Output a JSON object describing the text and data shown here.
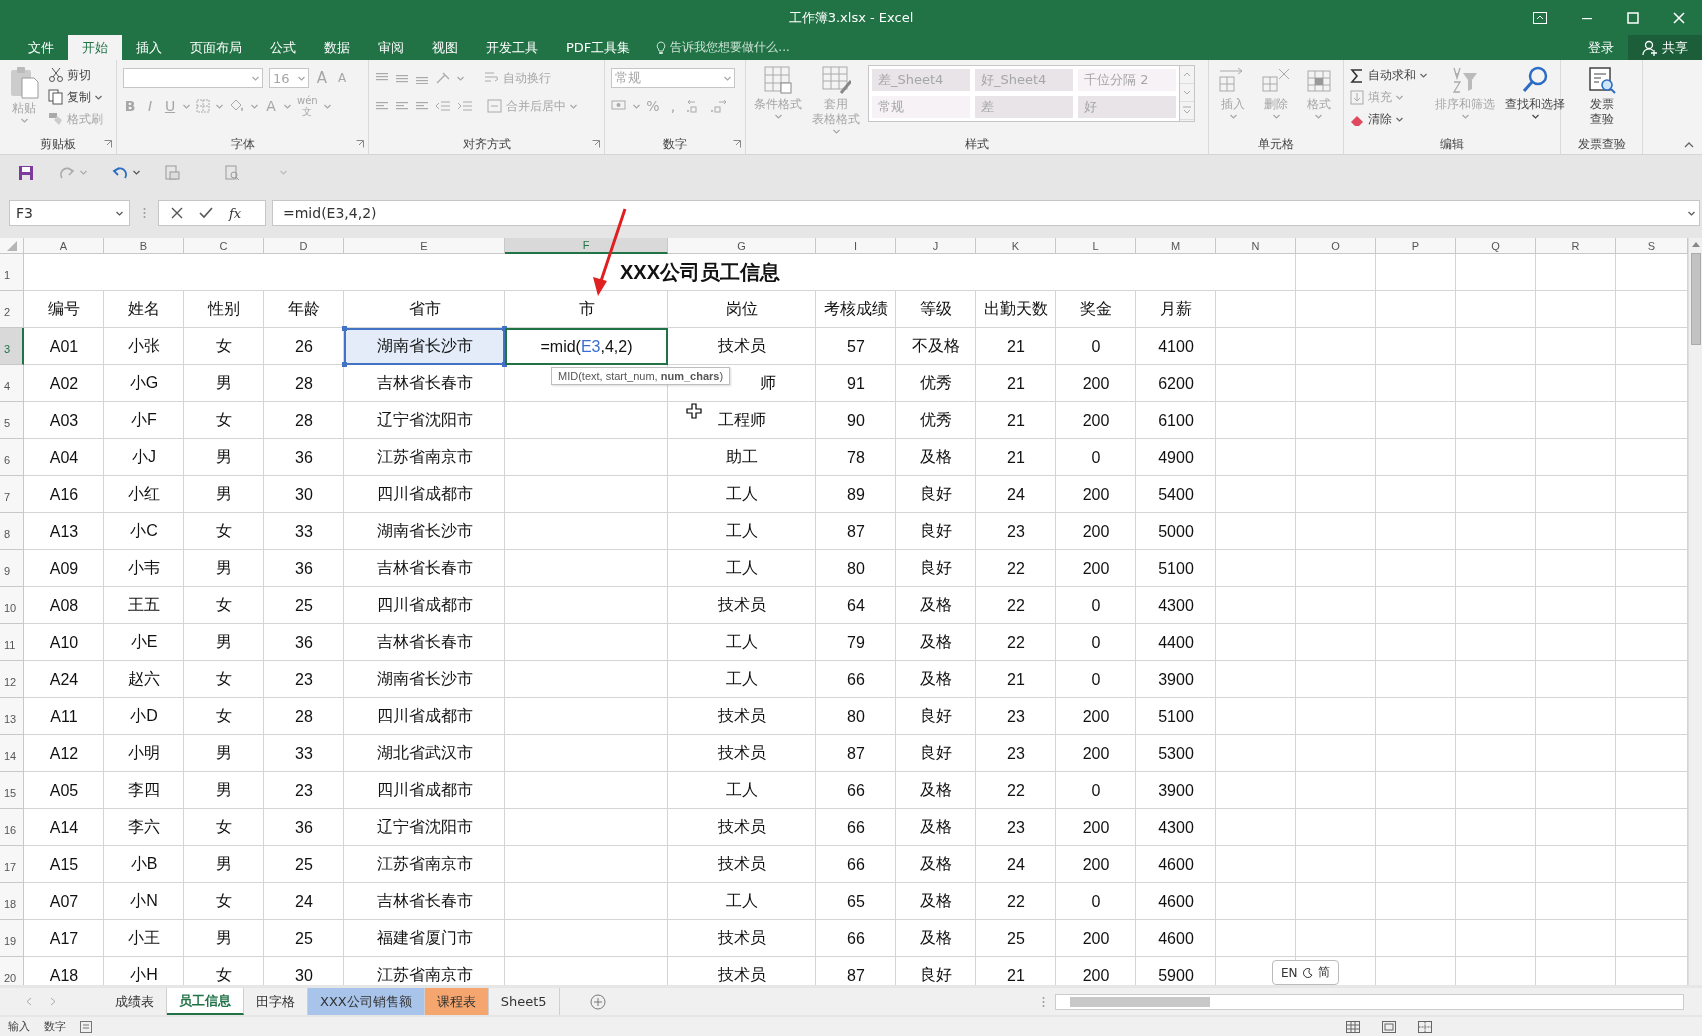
{
  "window": {
    "title": "工作簿3.xlsx - Excel"
  },
  "menu": {
    "tabs": [
      {
        "label": "文件",
        "selected": false
      },
      {
        "label": "开始",
        "selected": true
      },
      {
        "label": "插入",
        "selected": false
      },
      {
        "label": "页面布局",
        "selected": false
      },
      {
        "label": "公式",
        "selected": false
      },
      {
        "label": "数据",
        "selected": false
      },
      {
        "label": "审阅",
        "selected": false
      },
      {
        "label": "视图",
        "selected": false
      },
      {
        "label": "开发工具",
        "selected": false
      },
      {
        "label": "PDF工具集",
        "selected": false
      }
    ],
    "tell_me": {
      "placeholder": "告诉我您想要做什么..."
    },
    "sign_in": "登录",
    "share": "共享"
  },
  "ribbon": {
    "groups": [
      {
        "kind": "clipboard",
        "label": "剪贴板",
        "paste": {
          "label": "粘贴",
          "disabled": true
        },
        "actions": [
          {
            "label": "剪切",
            "disabled": false
          },
          {
            "label": "复制",
            "disabled": false
          },
          {
            "label": "格式刷",
            "disabled": true
          }
        ]
      },
      {
        "kind": "font",
        "label": "字体",
        "font_size": "16",
        "grow": "A",
        "shrink": "A",
        "styles": [
          "B",
          "I",
          "U"
        ],
        "font_color": "A",
        "phonetic": "wén",
        "phonetic_char": "文"
      },
      {
        "kind": "alignment",
        "label": "对齐方式",
        "actions": [
          {
            "label": "自动换行",
            "disabled": true
          },
          {
            "label": "合并后居中",
            "disabled": true
          }
        ]
      },
      {
        "kind": "number",
        "label": "数字",
        "format": "常规",
        "symbols": [
          "%",
          ","
        ]
      },
      {
        "kind": "styles",
        "label": "样式",
        "actions": [
          {
            "lines": [
              "条件格式"
            ],
            "disabled": true
          },
          {
            "lines": [
              "套用",
              "表格格式"
            ],
            "disabled": true
          }
        ],
        "gallery": [
          {
            "label": "差_Sheet4",
            "disabled": true
          },
          {
            "label": "好_Sheet4",
            "disabled": true
          },
          {
            "label": "千位分隔 2",
            "disabled": true
          },
          {
            "label": "常规",
            "disabled": true
          },
          {
            "label": "差",
            "disabled": true
          },
          {
            "label": "好",
            "disabled": true
          }
        ]
      },
      {
        "kind": "cells",
        "label": "单元格",
        "actions": [
          {
            "label": "插入",
            "disabled": true
          },
          {
            "label": "删除",
            "disabled": true
          },
          {
            "label": "格式",
            "disabled": true
          }
        ]
      },
      {
        "kind": "editing",
        "label": "编辑",
        "actions": [
          {
            "label": "自动求和",
            "disabled": false
          },
          {
            "label": "填充",
            "disabled": true
          },
          {
            "label": "清除",
            "disabled": false
          }
        ],
        "large": [
          {
            "label": "排序和筛选",
            "disabled": true
          },
          {
            "label": "查找和选择",
            "disabled": false
          }
        ]
      },
      {
        "kind": "invoice",
        "label": "发票查验",
        "action": {
          "lines": [
            "发票",
            "查验"
          ],
          "disabled": false
        }
      }
    ]
  },
  "formula_bar": {
    "name_box": "F3",
    "insert_function": "fx",
    "formula": "=mid(E3,4,2)"
  },
  "sheet": {
    "columns": [
      {
        "label": "A",
        "selected": false
      },
      {
        "label": "B",
        "selected": false
      },
      {
        "label": "C",
        "selected": false
      },
      {
        "label": "D",
        "selected": false
      },
      {
        "label": "E",
        "selected": false
      },
      {
        "label": "F",
        "selected": true
      },
      {
        "label": "G",
        "selected": false
      },
      {
        "label": "I",
        "selected": false
      },
      {
        "label": "J",
        "selected": false
      },
      {
        "label": "K",
        "selected": false
      },
      {
        "label": "L",
        "selected": false
      },
      {
        "label": "M",
        "selected": false
      },
      {
        "label": "N",
        "selected": false
      },
      {
        "label": "O",
        "selected": false
      },
      {
        "label": "P",
        "selected": false
      },
      {
        "label": "Q",
        "selected": false
      },
      {
        "label": "R",
        "selected": false
      },
      {
        "label": "S",
        "selected": false
      }
    ],
    "title_row": {
      "number": "1",
      "selected": false,
      "title": "XXX公司员工信息"
    },
    "rows": [
      {
        "number": "2",
        "selected": false,
        "cells": [
          "编号",
          "姓名",
          "性别",
          "年龄",
          "省市",
          "市",
          "岗位",
          "考核成绩",
          "等级",
          "出勤天数",
          "奖金",
          "月薪"
        ]
      },
      {
        "number": "3",
        "selected": true,
        "cells": [
          "A01",
          "小张",
          "女",
          "26",
          {
            "kind": "reference",
            "text": "湖南省长沙市"
          },
          {
            "kind": "editing",
            "parts": [
              {
                "kind": "text",
                "text": "=mid("
              },
              {
                "kind": "ref",
                "text": "E3"
              },
              {
                "kind": "text",
                "text": ",4,2)"
              }
            ]
          },
          "技术员",
          "57",
          "不及格",
          "21",
          "0",
          "4100"
        ]
      },
      {
        "number": "4",
        "selected": false,
        "cells": [
          "A02",
          "小G",
          "男",
          "28",
          "吉林省长春市",
          null,
          {
            "kind": "covered",
            "text": "师"
          },
          "91",
          "优秀",
          "21",
          "200",
          "6200"
        ]
      },
      {
        "number": "5",
        "selected": false,
        "cells": [
          "A03",
          "小F",
          "女",
          "28",
          "辽宁省沈阳市",
          null,
          "工程师",
          "90",
          "优秀",
          "21",
          "200",
          "6100"
        ]
      },
      {
        "number": "6",
        "selected": false,
        "cells": [
          "A04",
          "小J",
          "男",
          "36",
          "江苏省南京市",
          null,
          "助工",
          "78",
          "及格",
          "21",
          "0",
          "4900"
        ]
      },
      {
        "number": "7",
        "selected": false,
        "cells": [
          "A16",
          "小红",
          "男",
          "30",
          "四川省成都市",
          null,
          "工人",
          "89",
          "良好",
          "24",
          "200",
          "5400"
        ]
      },
      {
        "number": "8",
        "selected": false,
        "cells": [
          "A13",
          "小C",
          "女",
          "33",
          "湖南省长沙市",
          null,
          "工人",
          "87",
          "良好",
          "23",
          "200",
          "5000"
        ]
      },
      {
        "number": "9",
        "selected": false,
        "cells": [
          "A09",
          "小韦",
          "男",
          "36",
          "吉林省长春市",
          null,
          "工人",
          "80",
          "良好",
          "22",
          "200",
          "5100"
        ]
      },
      {
        "number": "10",
        "selected": false,
        "cells": [
          "A08",
          "王五",
          "女",
          "25",
          "四川省成都市",
          null,
          "技术员",
          "64",
          "及格",
          "22",
          "0",
          "4300"
        ]
      },
      {
        "number": "11",
        "selected": false,
        "cells": [
          "A10",
          "小E",
          "男",
          "36",
          "吉林省长春市",
          null,
          "工人",
          "79",
          "及格",
          "22",
          "0",
          "4400"
        ]
      },
      {
        "number": "12",
        "selected": false,
        "cells": [
          "A24",
          "赵六",
          "女",
          "23",
          "湖南省长沙市",
          null,
          "工人",
          "66",
          "及格",
          "21",
          "0",
          "3900"
        ]
      },
      {
        "number": "13",
        "selected": false,
        "cells": [
          "A11",
          "小D",
          "女",
          "28",
          "四川省成都市",
          null,
          "技术员",
          "80",
          "良好",
          "23",
          "200",
          "5100"
        ]
      },
      {
        "number": "14",
        "selected": false,
        "cells": [
          "A12",
          "小明",
          "男",
          "33",
          "湖北省武汉市",
          null,
          "技术员",
          "87",
          "良好",
          "23",
          "200",
          "5300"
        ]
      },
      {
        "number": "15",
        "selected": false,
        "cells": [
          "A05",
          "李四",
          "男",
          "23",
          "四川省成都市",
          null,
          "工人",
          "66",
          "及格",
          "22",
          "0",
          "3900"
        ]
      },
      {
        "number": "16",
        "selected": false,
        "cells": [
          "A14",
          "李六",
          "女",
          "36",
          "辽宁省沈阳市",
          null,
          "技术员",
          "66",
          "及格",
          "23",
          "200",
          "4300"
        ]
      },
      {
        "number": "17",
        "selected": false,
        "cells": [
          "A15",
          "小B",
          "男",
          "25",
          "江苏省南京市",
          null,
          "技术员",
          "66",
          "及格",
          "24",
          "200",
          "4600"
        ]
      },
      {
        "number": "18",
        "selected": false,
        "cells": [
          "A07",
          "小N",
          "女",
          "24",
          "吉林省长春市",
          null,
          "工人",
          "65",
          "及格",
          "22",
          "0",
          "4600"
        ]
      },
      {
        "number": "19",
        "selected": false,
        "cells": [
          "A17",
          "小王",
          "男",
          "25",
          "福建省厦门市",
          null,
          "技术员",
          "66",
          "及格",
          "25",
          "200",
          "4600"
        ]
      },
      {
        "number": "20",
        "selected": false,
        "cells": [
          "A18",
          "小H",
          "女",
          "30",
          "江苏省南京市",
          null,
          "技术员",
          "87",
          "良好",
          "21",
          "200",
          "5900"
        ]
      }
    ],
    "tooltip": "MID(text, start_num, **num_chars**)",
    "ime": {
      "language": "EN",
      "mode": "简"
    }
  },
  "sheet_tabs": [
    {
      "label": "成绩表",
      "selected": false
    },
    {
      "label": "员工信息",
      "selected": true
    },
    {
      "label": "田字格",
      "selected": false
    },
    {
      "label": "XXX公司销售额",
      "selected": false,
      "color": "#a9c4eb"
    },
    {
      "label": "课程表",
      "selected": false,
      "color": "#f4a66e"
    },
    {
      "label": "Sheet5",
      "selected": false
    }
  ],
  "status_bar": {
    "mode": "输入",
    "indicator": "数字"
  }
}
